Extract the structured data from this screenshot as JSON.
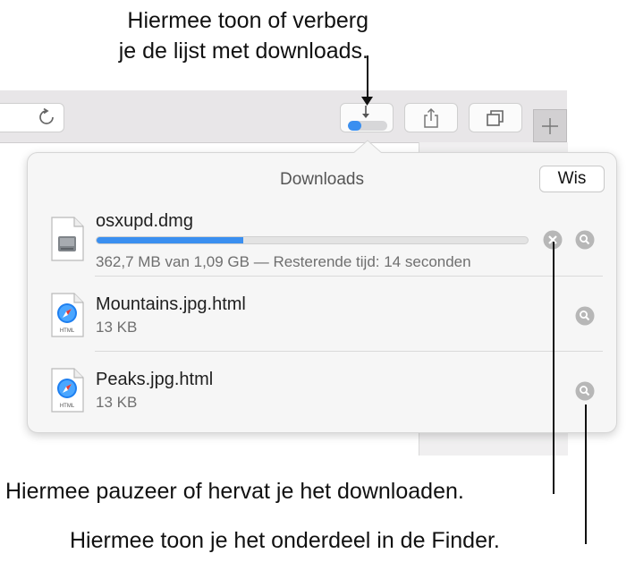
{
  "callouts": {
    "toggle_line1": "Hiermee toon of verberg",
    "toggle_line2": "je de lijst met downloads.",
    "pause": "Hiermee pauzeer of hervat je het downloaden.",
    "finder": "Hiermee toon je het onderdeel in de Finder."
  },
  "toolbar": {
    "download_progress_fraction": 0.35
  },
  "downloads": {
    "title": "Downloads",
    "clear_label": "Wis",
    "items": [
      {
        "name": "osxupd.dmg",
        "meta": "362,7 MB van 1,09 GB — Resterende tijd: 14 seconden",
        "progress_fraction": 0.34,
        "icon": "disk-image-icon"
      },
      {
        "name": "Mountains.jpg.html",
        "meta": "13 KB",
        "icon": "html-file-icon"
      },
      {
        "name": "Peaks.jpg.html",
        "meta": "13 KB",
        "icon": "html-file-icon"
      }
    ]
  },
  "colors": {
    "accent": "#3a8ff0"
  }
}
